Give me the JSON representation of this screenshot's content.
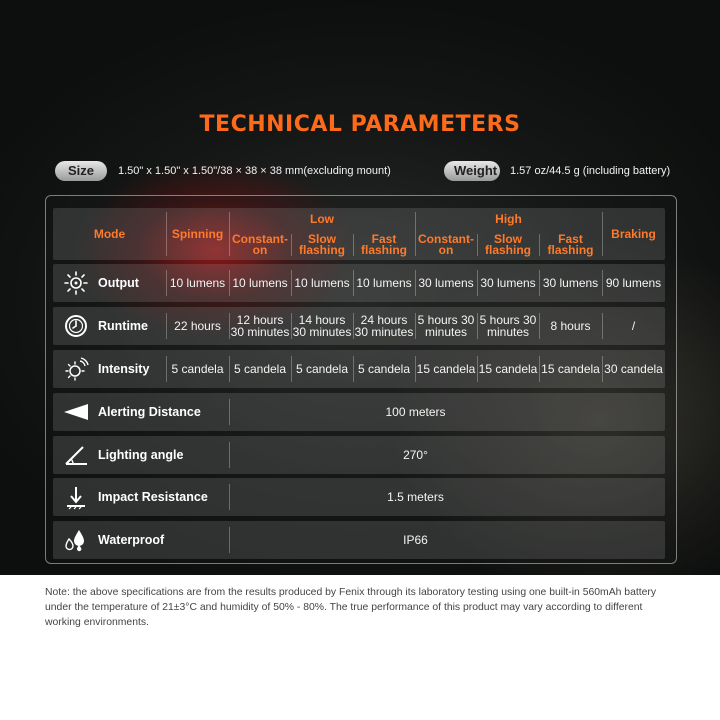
{
  "title": "TECHNICAL PARAMETERS",
  "size": {
    "label": "Size",
    "value": "1.50\" x 1.50\" x 1.50\"/38 × 38 × 38 mm(excluding mount)"
  },
  "weight": {
    "label": "Weight",
    "value": "1.57 oz/44.5 g (including battery)"
  },
  "table": {
    "mode_header": "Mode",
    "spinning_header": "Spinning",
    "low_header": "Low",
    "high_header": "High",
    "braking_header": "Braking",
    "sub": {
      "low_constant": "Constant-on",
      "low_slow": "Slow flashing",
      "low_fast": "Fast flashing",
      "high_constant": "Constant-on",
      "high_slow": "Slow flashing",
      "high_fast": "Fast flashing"
    },
    "output": {
      "label": "Output",
      "icon": "sun-icon",
      "values": [
        "10 lumens",
        "10 lumens",
        "10 lumens",
        "10 lumens",
        "30 lumens",
        "30 lumens",
        "30 lumens",
        "90 lumens"
      ]
    },
    "runtime": {
      "label": "Runtime",
      "icon": "clock-icon",
      "values": [
        "22 hours",
        "12 hours 30 minutes",
        "14 hours 30 minutes",
        "24 hours 30 minutes",
        "5 hours 30 minutes",
        "5 hours 30 minutes",
        "8 hours",
        "/"
      ]
    },
    "intensity": {
      "label": "Intensity",
      "icon": "intensity-icon",
      "values": [
        "5 candela",
        "5 candela",
        "5 candela",
        "5 candela",
        "15 candela",
        "15 candela",
        "15 candela",
        "30 candela"
      ]
    },
    "alerting": {
      "label": "Alerting Distance",
      "icon": "beam-icon",
      "value": "100 meters"
    },
    "angle": {
      "label": "Lighting angle",
      "icon": "angle-icon",
      "value": "270°"
    },
    "impact": {
      "label": "Impact Resistance",
      "icon": "impact-icon",
      "value": "1.5 meters"
    },
    "waterproof": {
      "label": "Waterproof",
      "icon": "water-drops-icon",
      "value": "IP66"
    }
  },
  "note": "Note: the above specifications are from the results produced by Fenix through its laboratory testing using one built-in 560mAh battery under the temperature of 21±3°C and humidity of 50% - 80%. The true performance of this product may vary according to different working environments.",
  "colors": {
    "accent": "#ff6a1a",
    "header": "#ff7a2a"
  }
}
